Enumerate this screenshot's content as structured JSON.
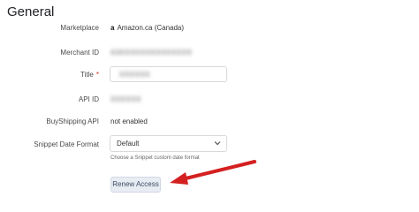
{
  "section": {
    "title": "General"
  },
  "fields": {
    "marketplace": {
      "label": "Marketplace",
      "logo": "a",
      "value": "Amazon.ca (Canada)"
    },
    "merchant_id": {
      "label": "Merchant ID",
      "value": "A3XXXXXXXXXXXXXX"
    },
    "title": {
      "label": "Title",
      "required_mark": "*",
      "value": "XXXXXX"
    },
    "api_id": {
      "label": "API ID",
      "value": "XXXXXX"
    },
    "buyshipping_api": {
      "label": "BuyShipping API",
      "value": "not enabled"
    },
    "snippet_date_format": {
      "label": "Snippet Date Format",
      "selected": "Default",
      "hint": "Choose a Snippet custom date format"
    }
  },
  "actions": {
    "renew_label": "Renew Access"
  },
  "colors": {
    "arrow": "#d42020",
    "button_bg": "#e8ecf3",
    "button_text": "#3b4a63"
  }
}
